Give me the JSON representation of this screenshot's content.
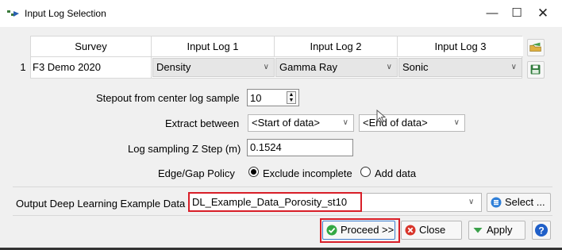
{
  "window": {
    "title": "Input Log Selection",
    "minimize_label": "—",
    "maximize_label": "☐",
    "close_label": "✕"
  },
  "table": {
    "headers": [
      "Survey",
      "Input Log 1",
      "Input Log 2",
      "Input Log 3"
    ],
    "rows": [
      {
        "index": "1",
        "survey": "F3 Demo 2020",
        "log1": "Density",
        "log2": "Gamma Ray",
        "log3": "Sonic"
      }
    ]
  },
  "form": {
    "stepout_label": "Stepout from center log sample",
    "stepout_value": "10",
    "extract_label": "Extract between",
    "extract_start": "<Start of data>",
    "extract_end": "<End of data>",
    "zstep_label": "Log sampling Z Step (m)",
    "zstep_value": "0.1524",
    "policy_label": "Edge/Gap Policy",
    "policy_options": [
      "Exclude incomplete",
      "Add data"
    ],
    "policy_selected": "Exclude incomplete"
  },
  "output": {
    "label": "Output Deep Learning Example Data",
    "value": "DL_Example_Data_Porosity_st10",
    "select_label": "Select ..."
  },
  "buttons": {
    "proceed": "Proceed >>",
    "close": "Close",
    "apply": "Apply"
  },
  "colors": {
    "highlight": "#d81e28",
    "accent": "#3f7fd0"
  }
}
